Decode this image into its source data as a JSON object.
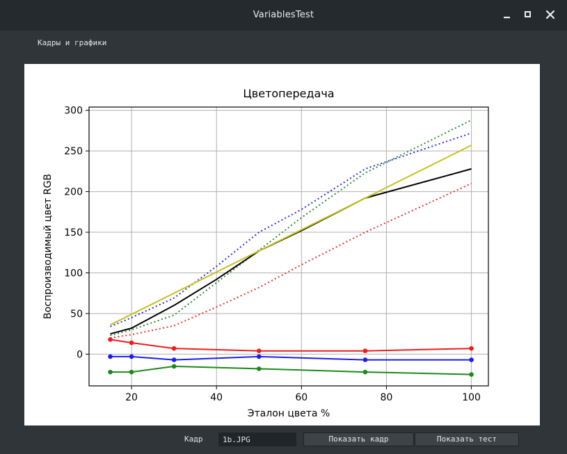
{
  "window": {
    "title": "VariablesTest",
    "controls": [
      "minimize-icon",
      "maximize-icon",
      "close-icon"
    ]
  },
  "tabs": [
    {
      "label": "Кадры и графики"
    }
  ],
  "footer": {
    "frame_label": "Кадр",
    "frame_value": "1b.JPG",
    "show_frame_label": "Показать кадр",
    "show_test_label": "Показать тест"
  },
  "chart_data": {
    "type": "line",
    "title": "Цветопередача",
    "xlabel": "Эталон цвета %",
    "ylabel": "Воспроизводимый цвет RGB",
    "xlim": [
      10,
      104
    ],
    "ylim": [
      -39,
      304
    ],
    "xticks": [
      20,
      40,
      60,
      80,
      100
    ],
    "yticks": [
      0,
      50,
      100,
      150,
      200,
      250,
      300
    ],
    "grid": true,
    "series": [
      {
        "color": "#2a2aee",
        "style": "dotted",
        "markers": false,
        "x": [
          15,
          20,
          30,
          40,
          50,
          60,
          75,
          100
        ],
        "y": [
          34,
          45,
          69,
          108,
          150,
          178,
          228,
          272
        ]
      },
      {
        "color": "#2a8a2a",
        "style": "dotted",
        "markers": false,
        "x": [
          15,
          20,
          30,
          40,
          50,
          60,
          75,
          100
        ],
        "y": [
          23,
          30,
          48,
          88,
          128,
          168,
          223,
          288
        ]
      },
      {
        "color": "#ee3030",
        "style": "dotted",
        "markers": false,
        "x": [
          15,
          20,
          30,
          40,
          50,
          60,
          75,
          100
        ],
        "y": [
          20,
          24,
          35,
          58,
          82,
          110,
          150,
          210
        ]
      },
      {
        "color": "#000000",
        "style": "solid",
        "markers": false,
        "x": [
          15,
          20,
          30,
          40,
          50,
          60,
          75,
          100
        ],
        "y": [
          25,
          32,
          60,
          92,
          127,
          152,
          192,
          228
        ]
      },
      {
        "color": "#c8c020",
        "style": "solid",
        "markers": false,
        "x": [
          15,
          100
        ],
        "y": [
          36,
          257
        ]
      },
      {
        "color": "#ee1c1c",
        "style": "solid",
        "markers": true,
        "x": [
          15,
          20,
          30,
          50,
          75,
          100
        ],
        "y": [
          18,
          14,
          7,
          4,
          4,
          7
        ]
      },
      {
        "color": "#1c1cee",
        "style": "solid",
        "markers": true,
        "x": [
          15,
          20,
          30,
          50,
          75,
          100
        ],
        "y": [
          -3,
          -3,
          -7,
          -3,
          -7,
          -7
        ]
      },
      {
        "color": "#1a8a1a",
        "style": "solid",
        "markers": true,
        "x": [
          15,
          20,
          30,
          50,
          75,
          100
        ],
        "y": [
          -22,
          -22,
          -15,
          -18,
          -22,
          -25
        ]
      }
    ]
  }
}
